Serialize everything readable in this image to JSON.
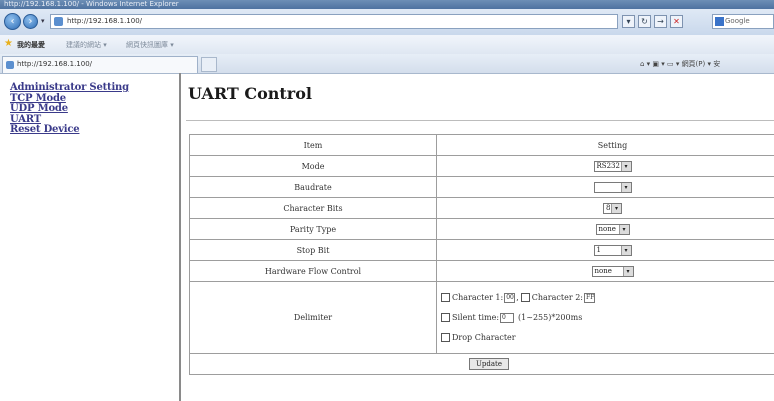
{
  "window": {
    "title": "http://192.168.1.100/ - Windows Internet Explorer"
  },
  "addressbar": {
    "url": "http://192.168.1.100/",
    "search_placeholder": "Google"
  },
  "favorites": {
    "label": "我的最愛",
    "items": [
      "建議的網站 ▾",
      "網頁快訊圖庫 ▾"
    ]
  },
  "tab": {
    "label": "http://192.168.1.100/",
    "commandbar": "⌂ ▾ ▣ ▾ ▭ ▾  網頁(P) ▾  安"
  },
  "sidebar": {
    "items": [
      {
        "label": "Administrator Setting"
      },
      {
        "label": "TCP Mode"
      },
      {
        "label": "UDP Mode"
      },
      {
        "label": "UART"
      },
      {
        "label": "Reset Device"
      }
    ]
  },
  "main": {
    "title": "UART Control",
    "table": {
      "col_item": "Item",
      "col_setting": "Setting",
      "rows": [
        {
          "label": "Mode",
          "value": "RS232"
        },
        {
          "label": "Baudrate",
          "value": ""
        },
        {
          "label": "Character Bits",
          "value": "8"
        },
        {
          "label": "Parity Type",
          "value": "none"
        },
        {
          "label": "Stop Bit",
          "value": "1"
        },
        {
          "label": "Hardware Flow Control",
          "value": "none"
        }
      ],
      "delimiter": {
        "label": "Delimiter",
        "char1_label": "Character 1:",
        "char1_value": "00",
        "sep": ",",
        "char2_label": "Character 2:",
        "char2_value": "FF",
        "silent_label": "Silent time:",
        "silent_value": "0",
        "silent_hint": "(1~255)*200ms",
        "drop_label": "Drop Character"
      },
      "update_label": "Update"
    }
  }
}
